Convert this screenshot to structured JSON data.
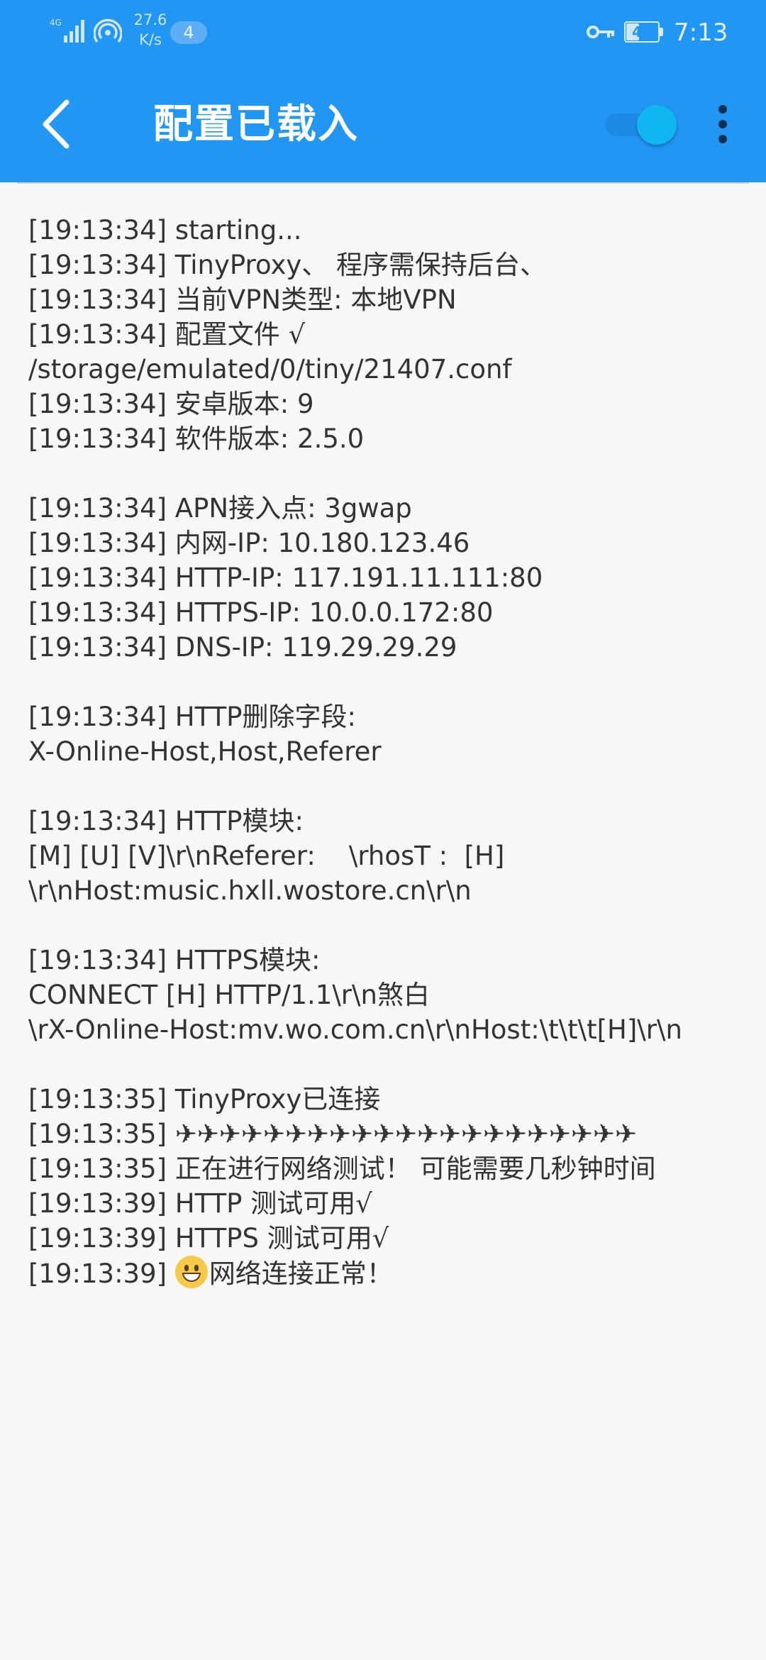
{
  "status_bar": {
    "network": "4G",
    "network_speed_value": "27.6",
    "network_speed_unit": "K/s",
    "notification_count": "4",
    "battery_level": "41",
    "battery_fraction": 0.41,
    "time": "7:13"
  },
  "app_bar": {
    "back_icon": "chevron-left-icon",
    "title": "配置已载入",
    "toggle_on": true,
    "menu_icon": "more-vertical-icon",
    "color": "#2196f3"
  },
  "log": {
    "lines": [
      "[19:13:34] starting...",
      "[19:13:34] TinyProxy、 程序需保持后台、",
      "[19:13:34] 当前VPN类型: 本地VPN",
      "[19:13:34] 配置文件 √",
      "/storage/emulated/0/tiny/21407.conf",
      "[19:13:34] 安卓版本: 9",
      "[19:13:34] 软件版本: 2.5.0",
      "",
      "[19:13:34] APN接入点: 3gwap",
      "[19:13:34] 内网-IP: 10.180.123.46",
      "[19:13:34] HTTP-IP: 117.191.11.111:80",
      "[19:13:34] HTTPS-IP: 10.0.0.172:80",
      "[19:13:34] DNS-IP: 119.29.29.29",
      "",
      "[19:13:34] HTTP删除字段:",
      "X-Online-Host,Host,Referer",
      "",
      "[19:13:34] HTTP模块:",
      "[M] [U] [V]\\r\\nReferer:    \\rhosT :  [H]",
      "\\r\\nHost:music.hxll.wostore.cn\\r\\n",
      "",
      "[19:13:34] HTTPS模块:",
      "CONNECT [H] HTTP/1.1\\r\\n煞白",
      "\\rX-Online-Host:mv.wo.com.cn\\r\\nHost:\\t\\t\\t[H]\\r\\n",
      "",
      "[19:13:35] TinyProxy已连接",
      "[19:13:35] ✈✈✈✈✈✈✈✈✈✈✈✈✈✈✈✈✈✈✈✈✈",
      "[19:13:35] 正在进行网络测试！ 可能需要几秒钟时间",
      "[19:13:39] HTTP 测试可用√",
      "[19:13:39] HTTPS 测试可用√"
    ],
    "last_line": {
      "prefix": "[19:13:39] ",
      "emoji_icon": "grinning-face-icon",
      "text": "网络连接正常！"
    }
  }
}
